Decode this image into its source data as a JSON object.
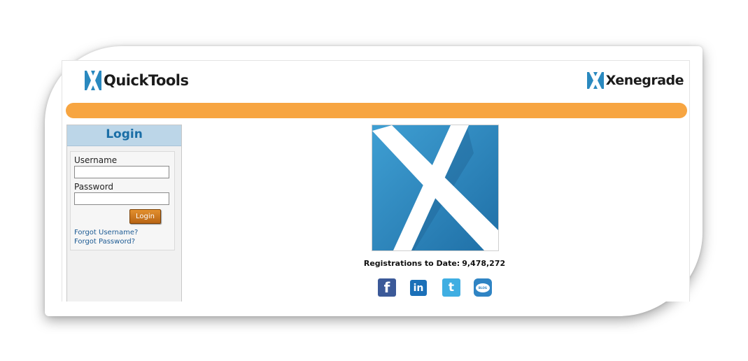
{
  "header": {
    "app_name": "QuickTools",
    "brand_name": "Xenegrade"
  },
  "login": {
    "title": "Login",
    "username_label": "Username",
    "username_value": "",
    "password_label": "Password",
    "password_value": "",
    "submit_label": "Login",
    "forgot_username": "Forgot Username?",
    "forgot_password": "Forgot Password?"
  },
  "main": {
    "registrations_label": "Registrations to Date:",
    "registrations_count": "9,478,272"
  },
  "social": {
    "facebook": "f",
    "linkedin": "in",
    "twitter": "t",
    "blog": "BLOG"
  },
  "colors": {
    "accent_orange": "#f7a541",
    "brand_blue": "#2a89bf",
    "login_header_bg": "#bcd6e8",
    "login_title": "#1a6ea6"
  },
  "icons": [
    "quicktools-logo-icon",
    "xenegrade-logo-icon",
    "facebook-icon",
    "linkedin-icon",
    "twitter-icon",
    "blog-icon"
  ]
}
